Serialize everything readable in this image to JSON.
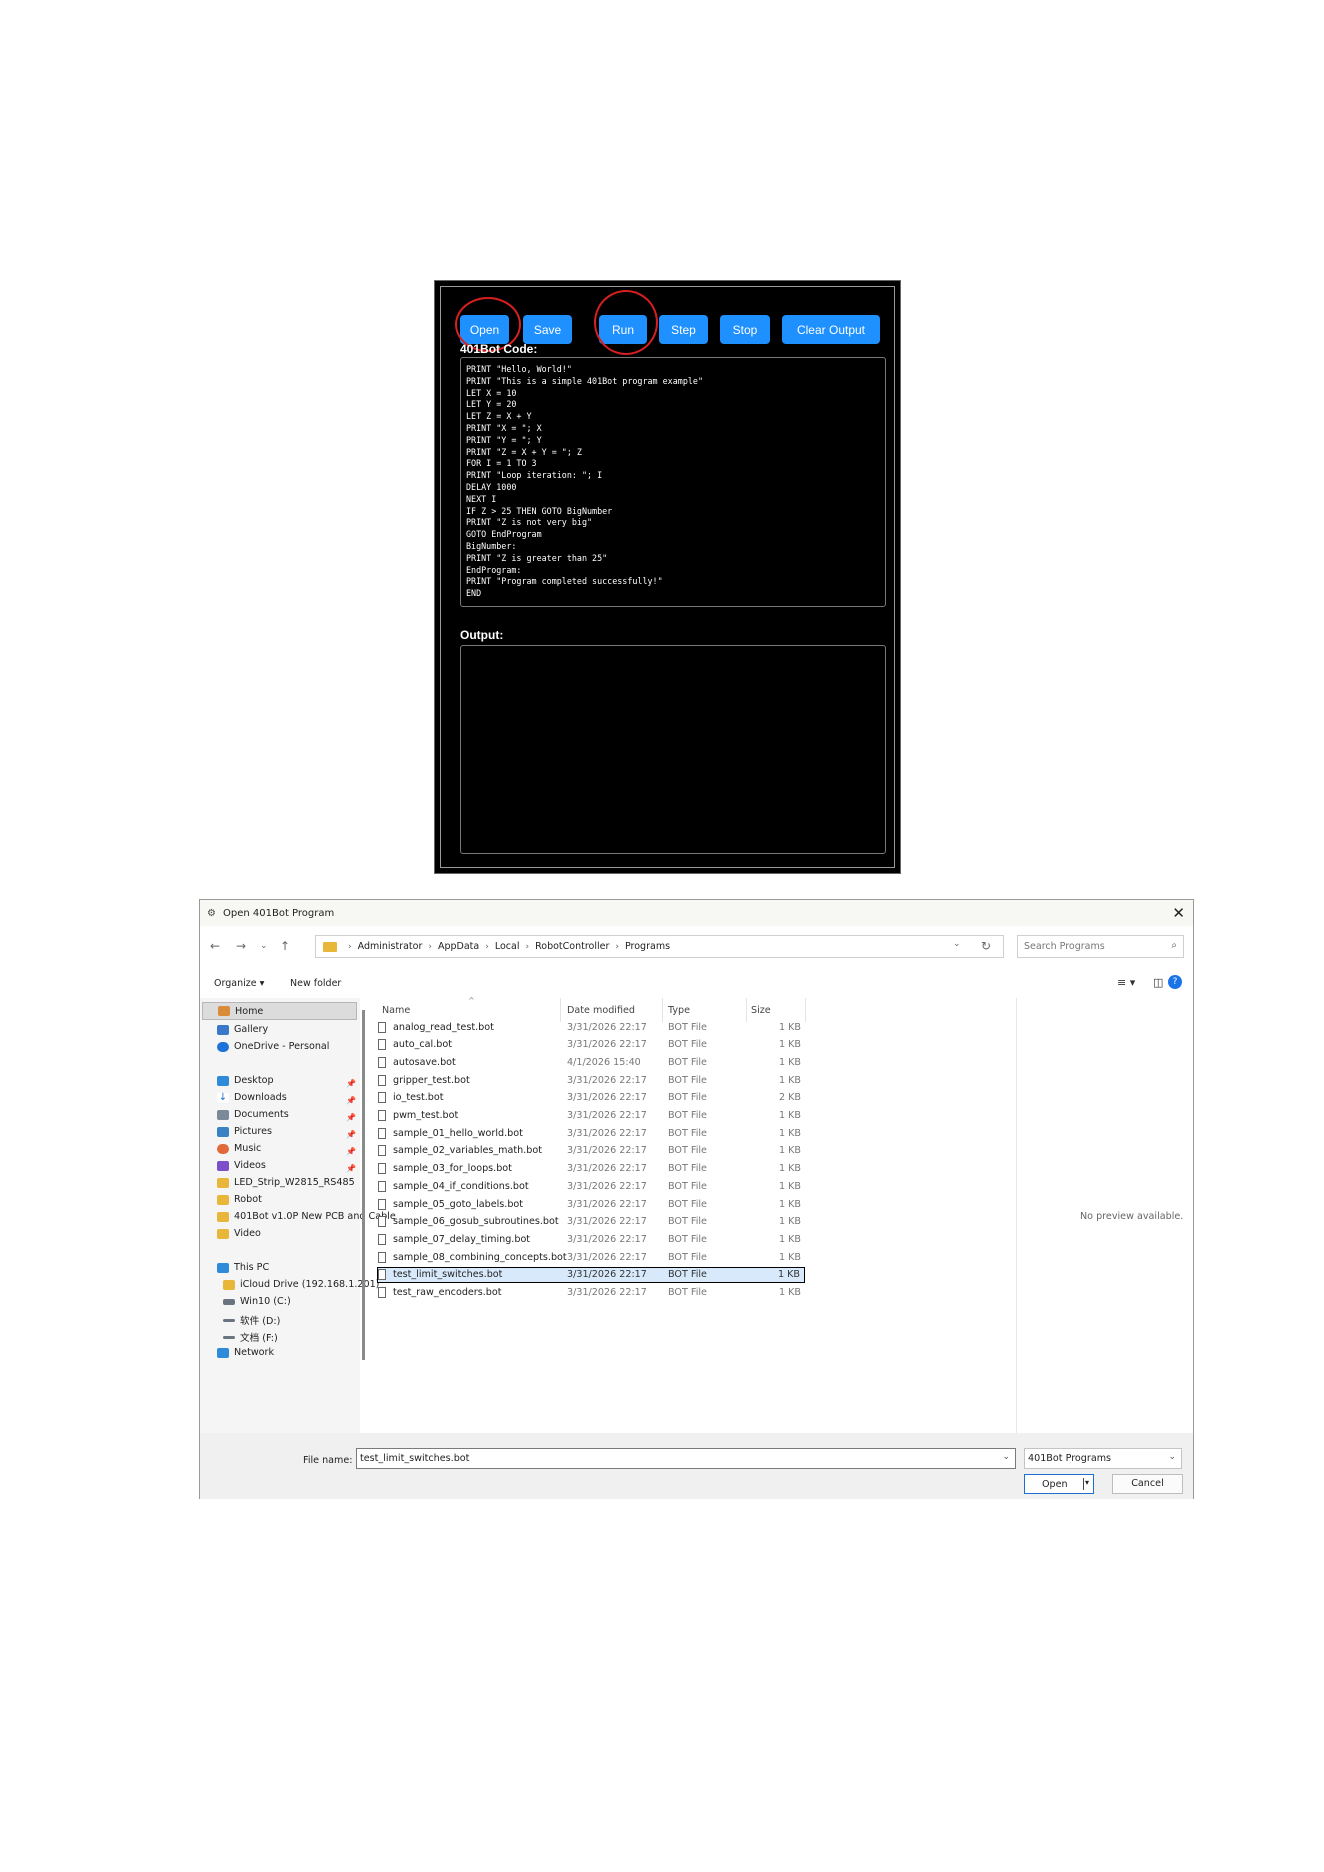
{
  "editor": {
    "buttons": {
      "open": "Open",
      "save": "Save",
      "run": "Run",
      "step": "Step",
      "stop": "Stop",
      "clear_output": "Clear Output"
    },
    "code_label": "401Bot Code:",
    "output_label": "Output:",
    "code_lines": [
      "PRINT \"Hello, World!\"",
      "PRINT \"This is a simple 401Bot program example\"",
      "LET X = 10",
      "LET Y = 20",
      "LET Z = X + Y",
      "PRINT \"X = \"; X",
      "PRINT \"Y = \"; Y",
      "PRINT \"Z = X + Y = \"; Z",
      "FOR I = 1 TO 3",
      "PRINT \"Loop iteration: \"; I",
      "DELAY 1000",
      "NEXT I",
      "IF Z > 25 THEN GOTO BigNumber",
      "PRINT \"Z is not very big\"",
      "GOTO EndProgram",
      "BigNumber:",
      "PRINT \"Z is greater than 25\"",
      "EndProgram:",
      "PRINT \"Program completed successfully!\"",
      "END"
    ],
    "colors": {
      "button": "#1e90ff",
      "annotation_ring": "#d62020",
      "background": "#000000"
    }
  },
  "dialog": {
    "title": "Open 401Bot Program",
    "breadcrumb": [
      "Administrator",
      "AppData",
      "Local",
      "RobotController",
      "Programs"
    ],
    "search_placeholder": "Search Programs",
    "toolbar": {
      "organize": "Organize ▾",
      "new_folder": "New folder"
    },
    "nav": {
      "quick": [
        "Home",
        "Gallery",
        "OneDrive - Personal"
      ],
      "pinned": [
        "Desktop",
        "Downloads",
        "Documents",
        "Pictures",
        "Music",
        "Videos"
      ],
      "folders": [
        "LED_Strip_W2815_RS485",
        "Robot",
        "401Bot v1.0P New PCB and Cable",
        "Video"
      ],
      "this_pc": "This PC",
      "drives": [
        "iCloud Drive (192.168.1.201)",
        "Win10 (C:)",
        "软件 (D:)",
        "文档 (F:)"
      ],
      "network": "Network"
    },
    "columns": {
      "name": "Name",
      "date": "Date modified",
      "type": "Type",
      "size": "Size"
    },
    "files": [
      {
        "name": "analog_read_test.bot",
        "date": "3/31/2026 22:17",
        "type": "BOT File",
        "size": "1 KB"
      },
      {
        "name": "auto_cal.bot",
        "date": "3/31/2026 22:17",
        "type": "BOT File",
        "size": "1 KB"
      },
      {
        "name": "autosave.bot",
        "date": "4/1/2026 15:40",
        "type": "BOT File",
        "size": "1 KB"
      },
      {
        "name": "gripper_test.bot",
        "date": "3/31/2026 22:17",
        "type": "BOT File",
        "size": "1 KB"
      },
      {
        "name": "io_test.bot",
        "date": "3/31/2026 22:17",
        "type": "BOT File",
        "size": "2 KB"
      },
      {
        "name": "pwm_test.bot",
        "date": "3/31/2026 22:17",
        "type": "BOT File",
        "size": "1 KB"
      },
      {
        "name": "sample_01_hello_world.bot",
        "date": "3/31/2026 22:17",
        "type": "BOT File",
        "size": "1 KB"
      },
      {
        "name": "sample_02_variables_math.bot",
        "date": "3/31/2026 22:17",
        "type": "BOT File",
        "size": "1 KB"
      },
      {
        "name": "sample_03_for_loops.bot",
        "date": "3/31/2026 22:17",
        "type": "BOT File",
        "size": "1 KB"
      },
      {
        "name": "sample_04_if_conditions.bot",
        "date": "3/31/2026 22:17",
        "type": "BOT File",
        "size": "1 KB"
      },
      {
        "name": "sample_05_goto_labels.bot",
        "date": "3/31/2026 22:17",
        "type": "BOT File",
        "size": "1 KB"
      },
      {
        "name": "sample_06_gosub_subroutines.bot",
        "date": "3/31/2026 22:17",
        "type": "BOT File",
        "size": "1 KB"
      },
      {
        "name": "sample_07_delay_timing.bot",
        "date": "3/31/2026 22:17",
        "type": "BOT File",
        "size": "1 KB"
      },
      {
        "name": "sample_08_combining_concepts.bot",
        "date": "3/31/2026 22:17",
        "type": "BOT File",
        "size": "1 KB"
      },
      {
        "name": "test_limit_switches.bot",
        "date": "3/31/2026 22:17",
        "type": "BOT File",
        "size": "1 KB",
        "selected": true
      },
      {
        "name": "test_raw_encoders.bot",
        "date": "3/31/2026 22:17",
        "type": "BOT File",
        "size": "1 KB"
      }
    ],
    "preview_text": "No preview available.",
    "file_name_label": "File name:",
    "file_name_value": "test_limit_switches.bot",
    "file_type_filter": "401Bot Programs",
    "open_button": "Open",
    "cancel_button": "Cancel"
  }
}
